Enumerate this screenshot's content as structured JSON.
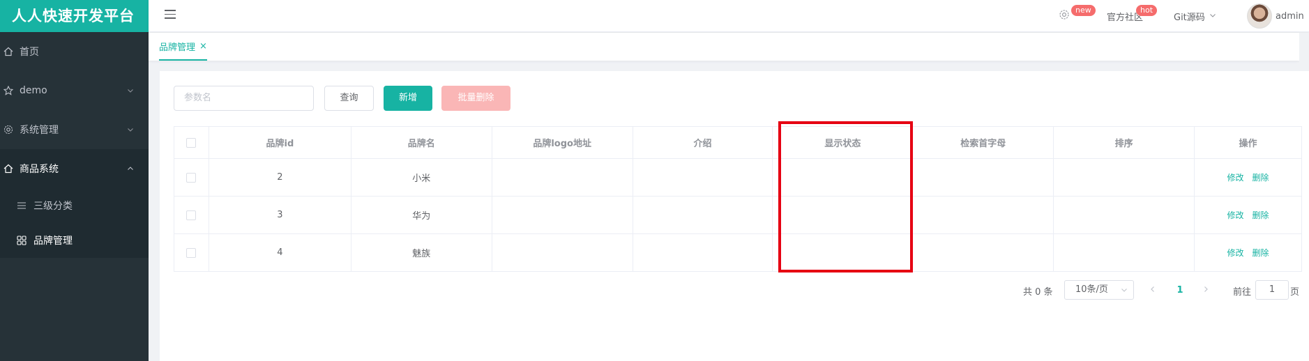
{
  "app": {
    "title": "人人快速开发平台"
  },
  "sidebar": {
    "items": [
      {
        "label": "首页",
        "icon": "home-icon"
      },
      {
        "label": "demo",
        "icon": "star-icon"
      },
      {
        "label": "系统管理",
        "icon": "gear-icon"
      },
      {
        "label": "商品系统",
        "icon": "home-icon"
      }
    ],
    "subitems": [
      {
        "label": "三级分类",
        "icon": "list-icon"
      },
      {
        "label": "品牌管理",
        "icon": "grid-icon"
      }
    ]
  },
  "header": {
    "settings_badge": "new",
    "community_label": "官方社区",
    "community_badge": "hot",
    "git_label": "Git源码",
    "user_name": "admin"
  },
  "tabs": [
    {
      "label": "品牌管理",
      "close": "×"
    }
  ],
  "search": {
    "placeholder": "参数名"
  },
  "toolbar": {
    "query_label": "查询",
    "add_label": "新增",
    "batch_delete_label": "批量删除"
  },
  "table": {
    "columns": [
      "品牌id",
      "品牌名",
      "品牌logo地址",
      "介绍",
      "显示状态",
      "检索首字母",
      "排序",
      "操作"
    ],
    "rows": [
      {
        "id": "2",
        "name": "小米",
        "logo": "",
        "descript": "",
        "show_status": "",
        "first_letter": "",
        "sort": ""
      },
      {
        "id": "3",
        "name": "华为",
        "logo": "",
        "descript": "",
        "show_status": "",
        "first_letter": "",
        "sort": ""
      },
      {
        "id": "4",
        "name": "魅族",
        "logo": "",
        "descript": "",
        "show_status": "",
        "first_letter": "",
        "sort": ""
      }
    ],
    "edit_label": "修改",
    "delete_label": "删除"
  },
  "pagination": {
    "total_text": "共 0 条",
    "page_size": "10条/页",
    "current_page": "1",
    "goto_label": "前往",
    "goto_value": "1",
    "page_suffix": "页"
  },
  "colors": {
    "accent": "#17b3a3",
    "sidebar_bg": "#263238",
    "badge": "#f56c6c",
    "highlight": "#e60012"
  }
}
